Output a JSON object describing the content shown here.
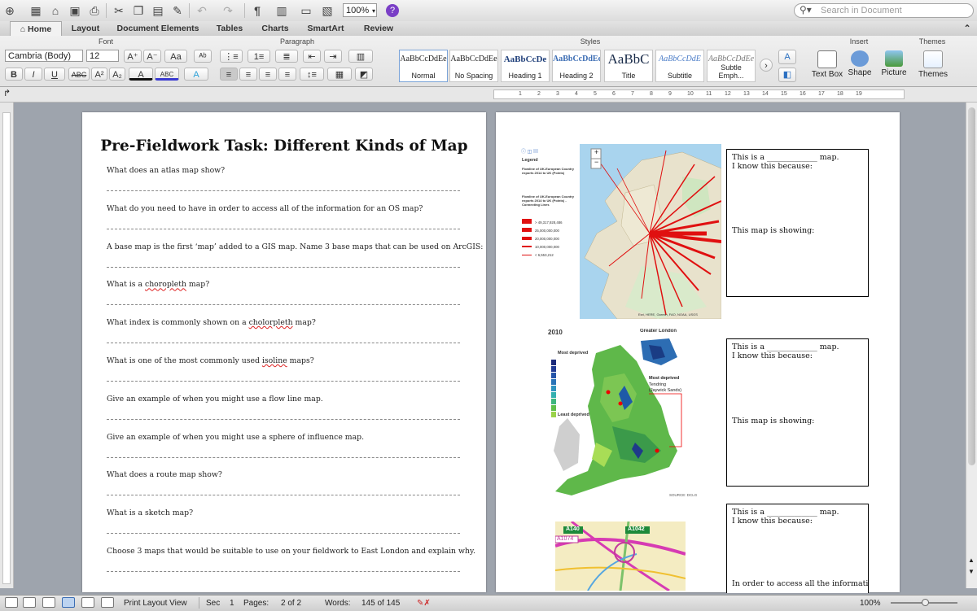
{
  "toolbar": {
    "zoom": "100%",
    "search_placeholder": "Search in Document",
    "paragraph_mark": "¶"
  },
  "ribbon_tabs": [
    "Home",
    "Layout",
    "Document Elements",
    "Tables",
    "Charts",
    "SmartArt",
    "Review"
  ],
  "ribbon": {
    "group_font": "Font",
    "group_paragraph": "Paragraph",
    "group_styles": "Styles",
    "group_insert": "Insert",
    "group_themes": "Themes",
    "font_name": "Cambria (Body)",
    "font_size": "12",
    "styles": [
      {
        "sample": "AaBbCcDdEe",
        "name": "Normal"
      },
      {
        "sample": "AaBbCcDdEe",
        "name": "No Spacing"
      },
      {
        "sample": "AaBbCcDe",
        "name": "Heading 1"
      },
      {
        "sample": "AaBbCcDdEe",
        "name": "Heading 2"
      },
      {
        "sample": "AaBbC",
        "name": "Title"
      },
      {
        "sample": "AaBbCcDdE",
        "name": "Subtitle"
      },
      {
        "sample": "AaBbCcDdEe",
        "name": "Subtle Emph..."
      }
    ],
    "insert": {
      "text_box": "Text Box",
      "shape": "Shape",
      "picture": "Picture"
    },
    "themes_label": "Themes"
  },
  "ruler_numbers": [
    "1",
    "2",
    "3",
    "4",
    "5",
    "6",
    "7",
    "8",
    "9",
    "10",
    "11",
    "12",
    "13",
    "14",
    "15",
    "16",
    "17",
    "18",
    "19"
  ],
  "page1": {
    "title": "Pre-Fieldwork Task: Different Kinds of Map",
    "questions": [
      {
        "pre": "What does an atlas map show?",
        "err": "",
        "post": ""
      },
      {
        "pre": "What do you need to have in order to access all of the information for an OS map?",
        "err": "",
        "post": ""
      },
      {
        "pre": "A base map is the first ‘map’ added to a GIS map. Name 3 base maps that can be used on ArcGIS:",
        "err": "",
        "post": ""
      },
      {
        "pre": "What is a ",
        "err": "choropleth",
        "post": " map?"
      },
      {
        "pre": "What index is commonly shown on a ",
        "err": "cholorpleth",
        "post": " map?"
      },
      {
        "pre": "What is one of the most commonly used ",
        "err": "isoline",
        "post": " maps?"
      },
      {
        "pre": "Give an example of when you might use a flow line map.",
        "err": "",
        "post": ""
      },
      {
        "pre": "Give an example of when you might use a sphere of influence map.",
        "err": "",
        "post": ""
      },
      {
        "pre": "What does a route map show?",
        "err": "",
        "post": ""
      },
      {
        "pre": "What is a sketch map?",
        "err": "",
        "post": ""
      },
      {
        "pre": "Choose 3 maps that would be suitable to use on your fieldwork to East London and explain why.",
        "err": "",
        "post": ""
      }
    ]
  },
  "page2": {
    "boxes": [
      {
        "line1": "This is a _____________ map.",
        "line2": "I know this because:",
        "line3": "This map is showing:"
      },
      {
        "line1": "This is a _____________ map.",
        "line2": "I know this because:",
        "line3": "This map is showing:"
      },
      {
        "line1": "This is a _____________ map.",
        "line2": "I know this because:",
        "line3": "In order to access all the information..."
      }
    ],
    "map1": {
      "legend_title": "Legend",
      "legend_sub1": "Flowline of UK-European Country exports 2014 to UK (Points)",
      "legend_sub2": "Flowline of UK-European Country exports 2014 to UK (Points) - Connecting Lines",
      "legend_values": [
        "> 49,317,928,486",
        "25,000,000,000",
        "20,000,000,000",
        "10,000,000,000",
        "< 6,553,212"
      ],
      "footer": "Esri, HERE, Garmin, FAO, NOAA, USGS"
    },
    "map2": {
      "year": "2010",
      "inset_label": "Greater London",
      "most_deprived": "Most deprived",
      "least_deprived": "Least deprived",
      "callout_title": "Most deprived",
      "callout_place": "Tendring",
      "callout_sub": "(Jaywick Sands)",
      "source": "SOURCE: DCLG"
    },
    "map3": {
      "roads": [
        "A140",
        "A1042",
        "A1074"
      ]
    }
  },
  "status": {
    "view": "Print Layout View",
    "sec_label": "Sec",
    "sec_value": "1",
    "pages_label": "Pages:",
    "pages_value": "2 of 2",
    "words_label": "Words:",
    "words_value": "145 of 145",
    "zoom": "100%"
  },
  "colors": {
    "flow_red": "#e01010",
    "ribbon_bg": "#e6e6e6",
    "page_bg": "#ffffff",
    "desk_bg": "#9ea4ad"
  }
}
